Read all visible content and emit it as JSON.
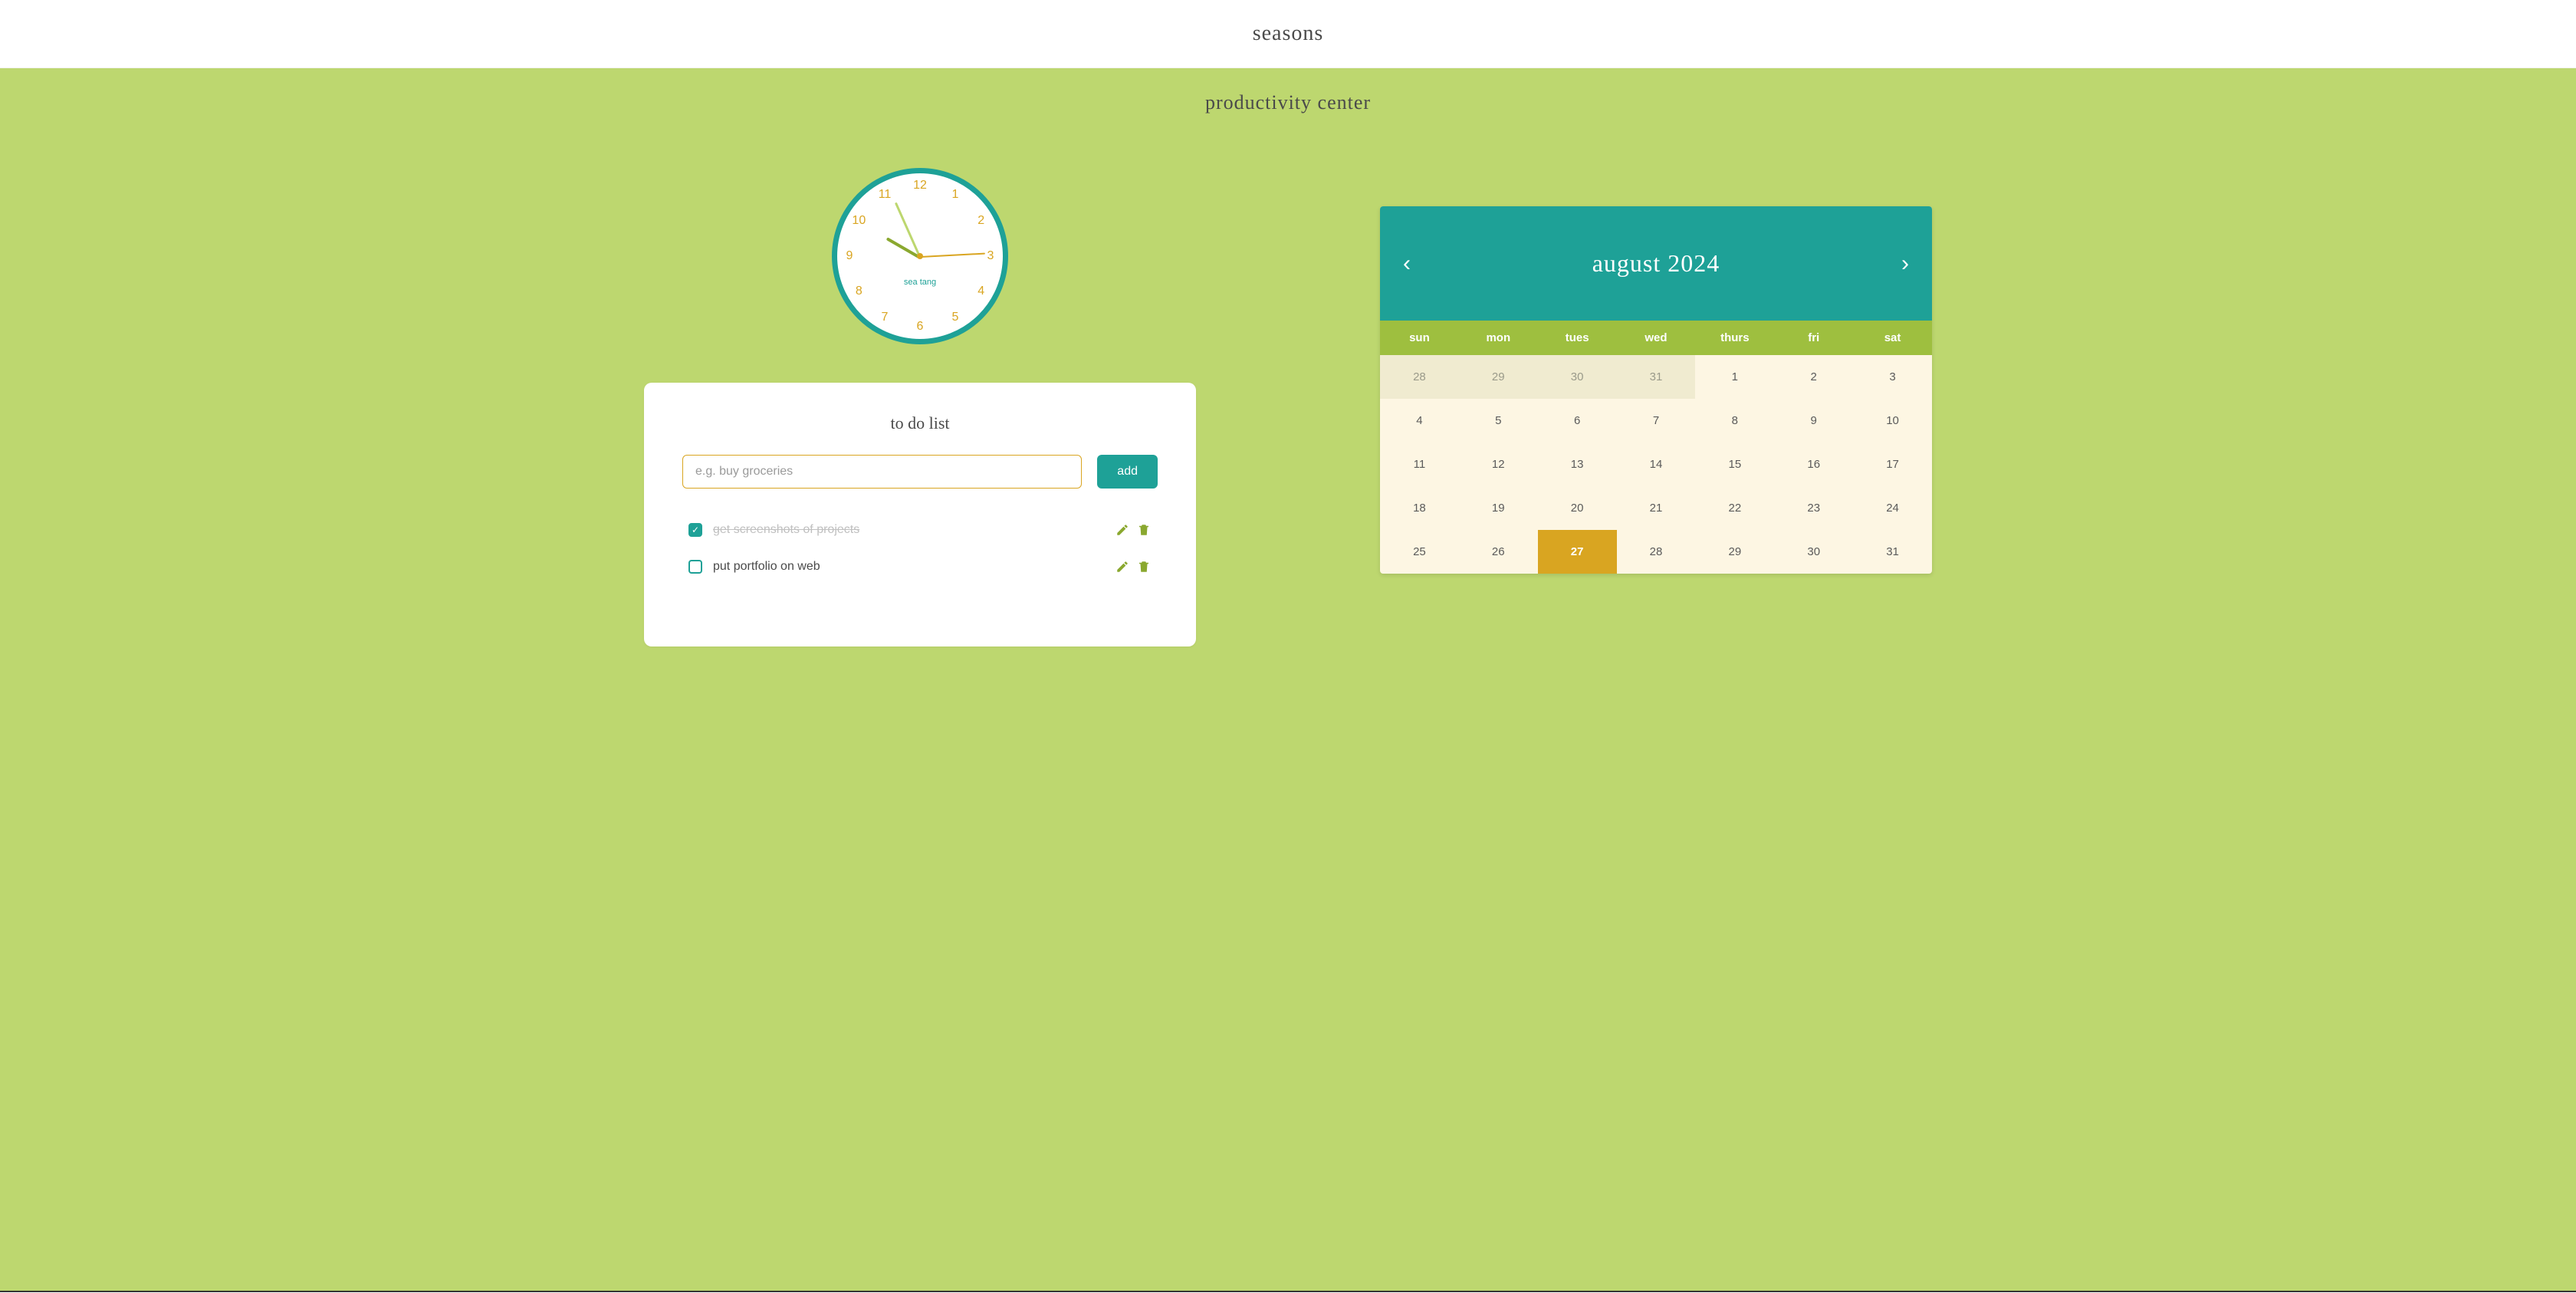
{
  "header": {
    "title": "seasons"
  },
  "subtitle": "productivity center",
  "clock": {
    "brand": "sea tang",
    "numbers": [
      "12",
      "1",
      "2",
      "3",
      "4",
      "5",
      "6",
      "7",
      "8",
      "9",
      "10",
      "11"
    ],
    "hour_angle": 210,
    "minute_angle": 246,
    "second_angle": 357
  },
  "todo": {
    "title": "to do list",
    "placeholder": "e.g. buy groceries",
    "add_label": "add",
    "items": [
      {
        "text": "get screenshots of projects",
        "checked": true
      },
      {
        "text": "put portfolio on web",
        "checked": false
      }
    ]
  },
  "calendar": {
    "title": "august 2024",
    "prev": "‹",
    "next": "›",
    "weekdays": [
      "sun",
      "mon",
      "tues",
      "wed",
      "thurs",
      "fri",
      "sat"
    ],
    "days": [
      {
        "n": "28",
        "dim": true
      },
      {
        "n": "29",
        "dim": true
      },
      {
        "n": "30",
        "dim": true
      },
      {
        "n": "31",
        "dim": true
      },
      {
        "n": "1"
      },
      {
        "n": "2"
      },
      {
        "n": "3"
      },
      {
        "n": "4"
      },
      {
        "n": "5"
      },
      {
        "n": "6"
      },
      {
        "n": "7"
      },
      {
        "n": "8"
      },
      {
        "n": "9"
      },
      {
        "n": "10"
      },
      {
        "n": "11"
      },
      {
        "n": "12"
      },
      {
        "n": "13"
      },
      {
        "n": "14"
      },
      {
        "n": "15"
      },
      {
        "n": "16"
      },
      {
        "n": "17"
      },
      {
        "n": "18"
      },
      {
        "n": "19"
      },
      {
        "n": "20"
      },
      {
        "n": "21"
      },
      {
        "n": "22"
      },
      {
        "n": "23"
      },
      {
        "n": "24"
      },
      {
        "n": "25"
      },
      {
        "n": "26"
      },
      {
        "n": "27",
        "today": true
      },
      {
        "n": "28"
      },
      {
        "n": "29"
      },
      {
        "n": "30"
      },
      {
        "n": "31"
      }
    ]
  }
}
